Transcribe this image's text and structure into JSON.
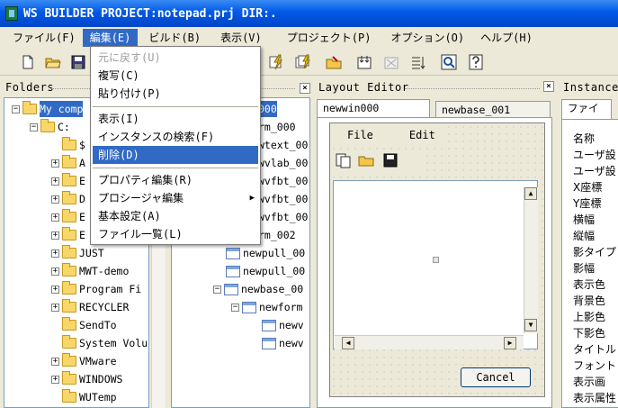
{
  "window": {
    "title": "WS BUILDER PROJECT:notepad.prj DIR:."
  },
  "menubar": {
    "items": [
      "ファイル(F)",
      "編集(E)",
      "ビルド(B)",
      "表示(V)",
      "プロジェクト(P)",
      "オプション(O)",
      "ヘルプ(H)"
    ]
  },
  "edit_menu": {
    "undo": "元に戻す(U)",
    "copy": "複写(C)",
    "paste": "貼り付け(P)",
    "show": "表示(I)",
    "find_instance": "インスタンスの検索(F)",
    "delete": "削除(D)",
    "property_edit": "プロパティ編集(R)",
    "procedure_edit": "プロシージャ編集",
    "basic_settings": "基本設定(A)",
    "file_list": "ファイル一覧(L)"
  },
  "folders": {
    "title": "Folders",
    "close": "×",
    "items": [
      {
        "label": "My comp",
        "selected": true
      },
      {
        "label": "C:"
      },
      {
        "label": "$"
      },
      {
        "label": "A"
      },
      {
        "label": "E"
      },
      {
        "label": "D"
      },
      {
        "label": "E"
      },
      {
        "label": "E"
      },
      {
        "label": "JUST"
      },
      {
        "label": "MWT-demo"
      },
      {
        "label": "Program Fi"
      },
      {
        "label": "RECYCLER"
      },
      {
        "label": "SendTo"
      },
      {
        "label": "System Volu"
      },
      {
        "label": "VMware"
      },
      {
        "label": "WINDOWS"
      },
      {
        "label": "WUTemp"
      }
    ]
  },
  "widgets_tree": {
    "items": [
      {
        "label": "000",
        "selected": true
      },
      {
        "label": "rm_000"
      },
      {
        "label": "wtext_00"
      },
      {
        "label": "wvlab_00"
      },
      {
        "label": "wvfbt_00"
      },
      {
        "label": "wvfbt_00"
      },
      {
        "label": "wvfbt_00"
      },
      {
        "label": "rm_002"
      },
      {
        "label": "newpull_00"
      },
      {
        "label": "newpull_00"
      },
      {
        "label": "newbase_00"
      },
      {
        "label": "newform"
      },
      {
        "label": "newv"
      },
      {
        "label": "newv"
      }
    ]
  },
  "layout_editor": {
    "title": "Layout Editor",
    "close": "×",
    "tabs": [
      "newwin000",
      "newbase_001"
    ],
    "form_menu": [
      "File",
      "Edit"
    ],
    "cancel_label": "Cancel"
  },
  "instance": {
    "title": "Instance",
    "tab": "ファイル",
    "properties": [
      "名称",
      "ユーザ設",
      "ユーザ設",
      "X座標",
      "Y座標",
      "横幅",
      "縦幅",
      "影タイプ",
      "影幅",
      "表示色",
      "背景色",
      "上影色",
      "下影色",
      "タイトル",
      "フォント",
      "表示画",
      "表示属性"
    ]
  }
}
